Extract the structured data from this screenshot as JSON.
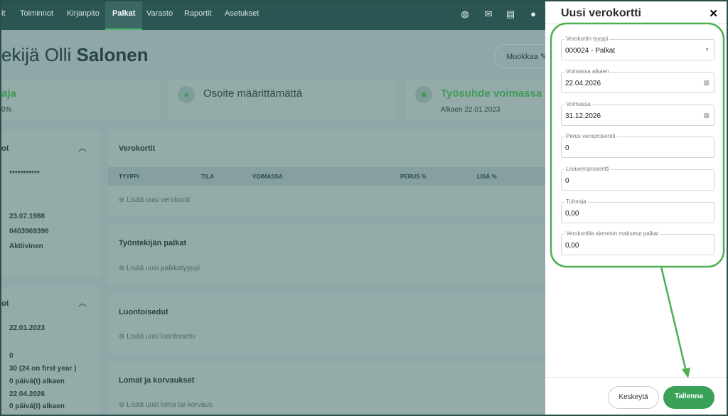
{
  "nav": {
    "items": [
      "it",
      "Toiminnot",
      "Kirjanpito",
      "Palkat",
      "Varasto",
      "Raportit",
      "Asetukset"
    ],
    "active": "Palkat",
    "icons": [
      "globe-icon",
      "mail-icon",
      "document-icon",
      "user-icon"
    ]
  },
  "page": {
    "title_prefix": "ekijä Olli ",
    "title_bold": "Salonen",
    "edit_label": "Muokkaa"
  },
  "summary": [
    {
      "title": "aja",
      "sub": "0%"
    },
    {
      "title": "Osoite määrittämättä",
      "sub": ""
    },
    {
      "title": "Työsuhde voimassa",
      "sub": "Alkaen 22.01.2023"
    }
  ],
  "left_cards": [
    {
      "title": "ot",
      "values": [
        "***********",
        "23.07.1988",
        "0403969396",
        "Aktiivinen"
      ]
    },
    {
      "title": "ot",
      "values": [
        "22.01.2023",
        "0",
        "30 (24 on first year )",
        "0 päivä(t) alkaen",
        "22.04.2026",
        "0 päivä(t) alkaen"
      ]
    }
  ],
  "sections": {
    "tax": {
      "title": "Verokortit",
      "columns": [
        "TYYPPI",
        "TILA",
        "VOIMASSA",
        "PERUS %",
        "LISÄ %"
      ],
      "add": "Lisää uusi verokortti"
    },
    "wages": {
      "title": "Työntekijän palkat",
      "add": "Lisää uusi palkkatyyppi"
    },
    "benefits": {
      "title": "Luontoisedut",
      "add": "Lisää uusi luontoisetu"
    },
    "holidays": {
      "title": "Lomat ja korvaukset",
      "add": "Lisää uusi loma tai korvaus"
    }
  },
  "drawer": {
    "title": "Uusi verokortti",
    "fields": [
      {
        "label": "Verokortin tyyppi",
        "value": "000024 - Palkat",
        "icon": "dropdown-icon"
      },
      {
        "label": "Voimassa alkaen",
        "value": "22.04.2026",
        "icon": "calendar-icon"
      },
      {
        "label": "Voimassa",
        "value": "31.12.2026",
        "icon": "calendar-icon"
      },
      {
        "label": "Perus veroprosentti",
        "value": "0"
      },
      {
        "label": "Lisäveroprosentti",
        "value": "0"
      },
      {
        "label": "Tuloraja",
        "value": "0,00"
      },
      {
        "label": "Verokortilla aiemmin maksetut palkat",
        "value": "0,00"
      }
    ],
    "cancel": "Keskeytä",
    "save": "Tallenna"
  },
  "colors": {
    "nav": "#2a5552",
    "accent": "#3f9b57",
    "highlight": "#4caf50"
  }
}
